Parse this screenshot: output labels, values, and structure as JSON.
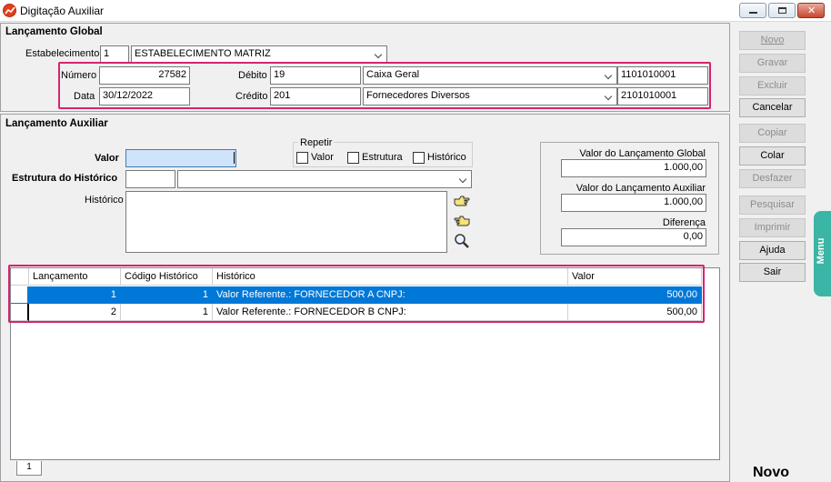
{
  "window": {
    "title": "Digitação Auxiliar"
  },
  "global": {
    "section_title": "Lançamento Global",
    "estabelecimento_label": "Estabelecimento",
    "estabelecimento_code": "1",
    "estabelecimento_name": "ESTABELECIMENTO MATRIZ",
    "numero_label": "Número",
    "numero_value": "27582",
    "data_label": "Data",
    "data_value": "30/12/2022",
    "debito_label": "Débito",
    "debito_code": "19",
    "debito_name": "Caixa Geral",
    "debito_account": "1101010001",
    "credito_label": "Crédito",
    "credito_code": "201",
    "credito_name": "Fornecedores Diversos",
    "credito_account": "2101010001"
  },
  "auxiliar": {
    "section_title": "Lançamento Auxiliar",
    "valor_label": "Valor",
    "valor_value": "",
    "estrutura_label": "Estrutura do Histórico",
    "estrutura_code": "",
    "estrutura_name": "",
    "historico_label": "Histórico",
    "historico_value": "",
    "repetir": {
      "title": "Repetir",
      "valor": "Valor",
      "estrutura": "Estrutura",
      "historico": "Histórico"
    }
  },
  "totals": {
    "global_label": "Valor do Lançamento Global",
    "global_value": "1.000,00",
    "auxiliar_label": "Valor do Lançamento Auxiliar",
    "auxiliar_value": "1.000,00",
    "diferenca_label": "Diferença",
    "diferenca_value": "0,00"
  },
  "grid": {
    "columns": [
      "Lançamento",
      "Código Histórico",
      "Histórico",
      "Valor"
    ],
    "rows": [
      {
        "lancamento": "1",
        "codigo": "1",
        "historico": "Valor Referente.: FORNECEDOR A CNPJ:",
        "valor": "500,00"
      },
      {
        "lancamento": "2",
        "codigo": "1",
        "historico": "Valor Referente.: FORNECEDOR B CNPJ:",
        "valor": "500,00"
      }
    ],
    "page_tab": "1"
  },
  "sidebar": {
    "novo": "Novo",
    "gravar": "Gravar",
    "excluir": "Excluir",
    "cancelar": "Cancelar",
    "copiar": "Copiar",
    "colar": "Colar",
    "desfazer": "Desfazer",
    "pesquisar": "Pesquisar",
    "imprimir": "Imprimir",
    "ajuda": "Ajuda",
    "sair": "Sair",
    "menu_tab": "Menu",
    "mode": "Novo"
  },
  "colors": {
    "selection": "#0078d7",
    "highlight": "#d6246e",
    "menu_tab": "#3bb5a5"
  }
}
